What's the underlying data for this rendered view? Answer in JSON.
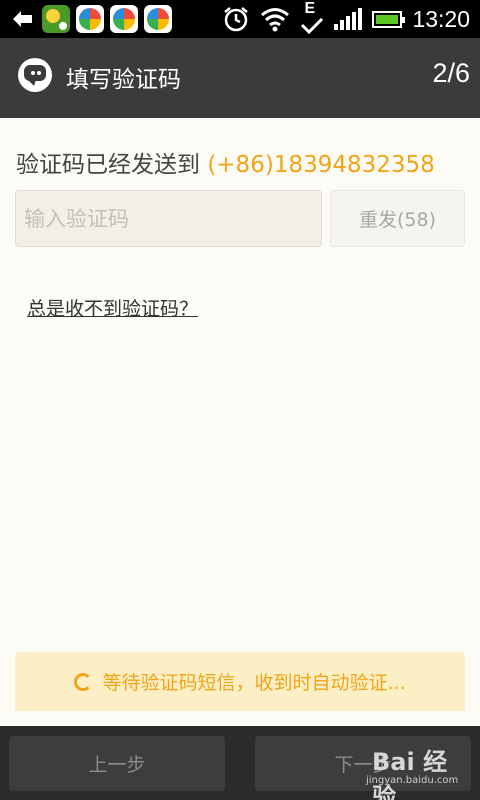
{
  "status_bar": {
    "time": "13:20",
    "network_letter": "E",
    "icons": [
      "back-arrow-icon",
      "app-icon",
      "pinwheel-app-icon",
      "alarm-icon",
      "wifi-icon",
      "signal-icon",
      "battery-icon"
    ]
  },
  "header": {
    "title": "填写验证码",
    "step": "2/6"
  },
  "verify": {
    "sent_prefix": "验证码已经发送到 ",
    "phone": "(+86)18394832358",
    "input_placeholder": "输入验证码",
    "input_value": "",
    "resend_label": "重发(58)",
    "help_link": "总是收不到验证码？"
  },
  "banner": {
    "text": "等待验证码短信，收到时自动验证..."
  },
  "footer": {
    "prev_label": "上一步",
    "next_label": "下一步"
  },
  "watermark": {
    "main": "Bai 经验",
    "sub": "jingyan.baidu.com"
  },
  "colors": {
    "accent": "#f2a417",
    "title_bar": "#3b3b3b",
    "background": "#fdfbf6"
  }
}
